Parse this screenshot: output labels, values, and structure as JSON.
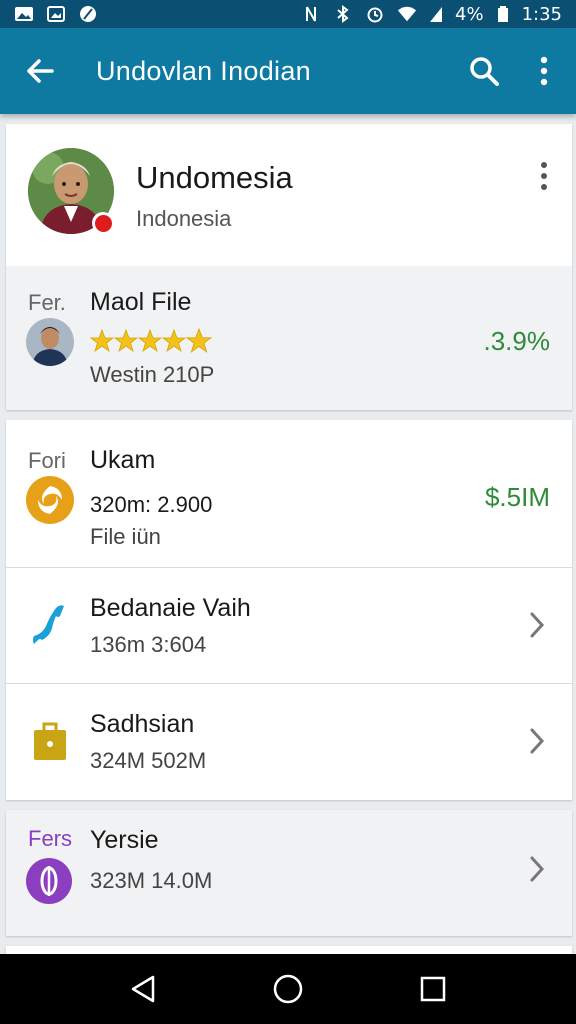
{
  "status_bar": {
    "battery_text": "4%",
    "time": "1:35"
  },
  "app_bar": {
    "title": "Undovlan Inodian"
  },
  "profile": {
    "name": "Undomesia",
    "subtitle": "Indonesia"
  },
  "file_item": {
    "tag": "Fer.",
    "title": "Maol File",
    "rating_stars": 5,
    "subtitle": "Westin 210P",
    "value": ".3.9%"
  },
  "list": [
    {
      "tag": "Fori",
      "title": "Ukam",
      "line1": "320m: 2.900",
      "line2": "File iün",
      "value": "$.5IM",
      "icon": "swirl-icon",
      "icon_color": "#e6a118"
    },
    {
      "title": "Bedanaie Vaih",
      "line1": "136m 3:604",
      "icon": "phone-icon",
      "icon_color": "#1aa0d6"
    },
    {
      "title": "Sadhsian",
      "line1": "324M 502M",
      "icon": "briefcase-icon",
      "icon_color": "#c9a516"
    }
  ],
  "last_item": {
    "tag": "Fers",
    "title": "Yersie",
    "line1": "323M 14.0M",
    "icon": "leaf-icon",
    "icon_color": "#8b3fc0"
  },
  "colors": {
    "app_bar": "#0e7aa2",
    "status_bar": "#0b4f73",
    "value_green": "#2e8b3a"
  }
}
